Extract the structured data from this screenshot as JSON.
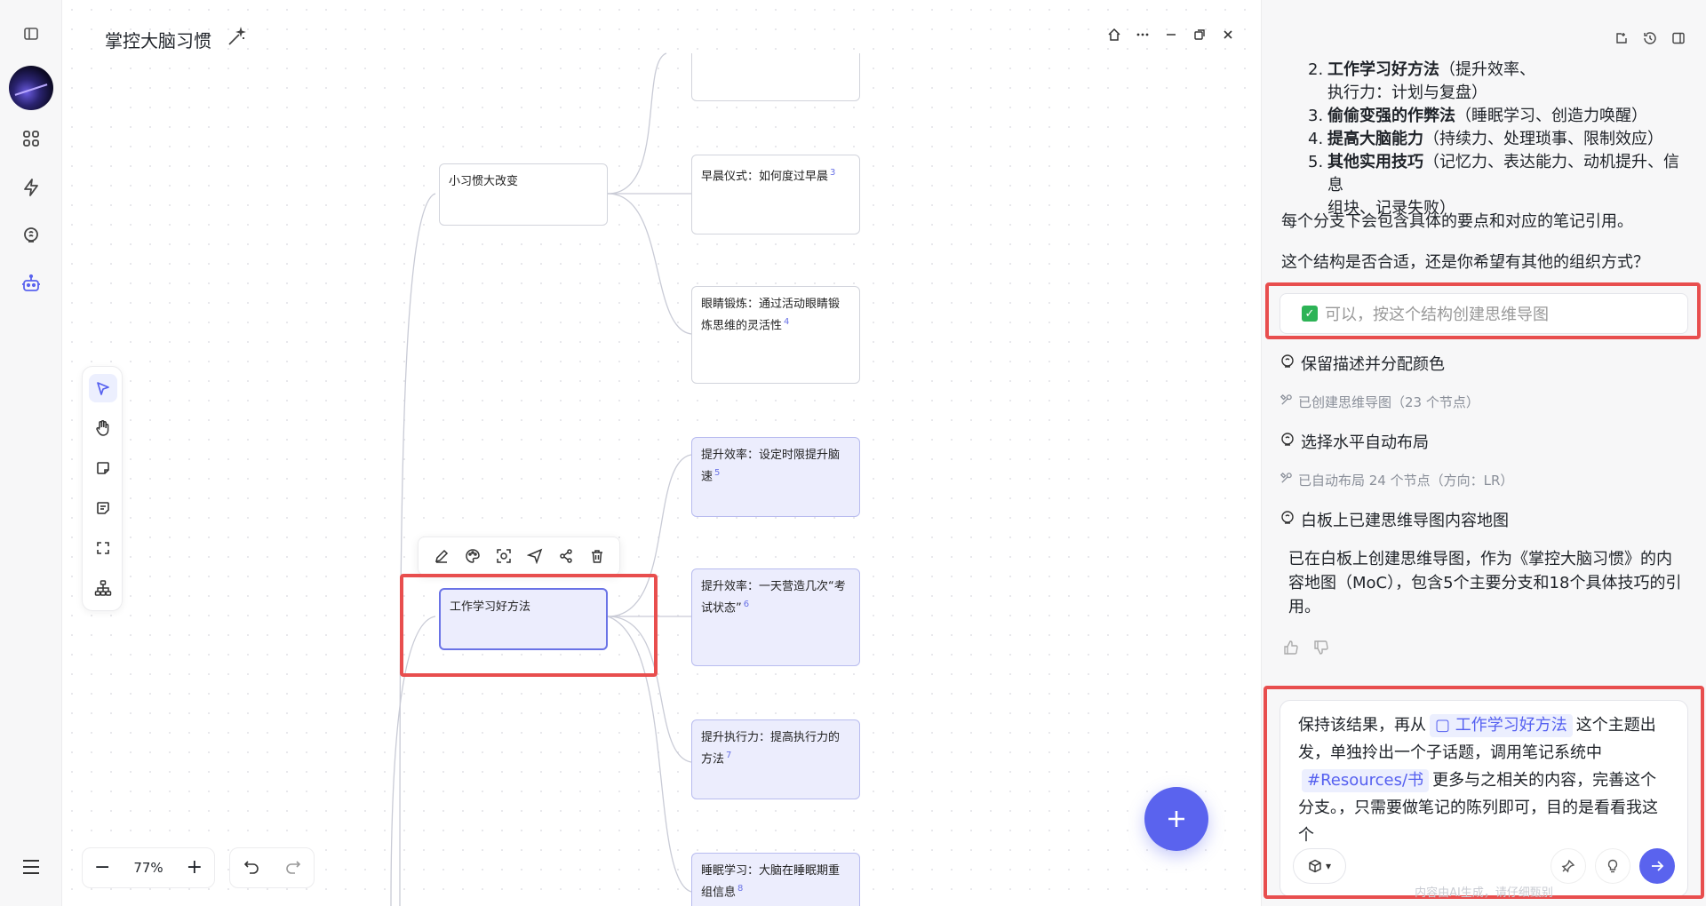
{
  "canvas": {
    "doc_title": "掌控大脑习惯",
    "zoom": "77%",
    "nodes": {
      "root_small": "小习惯大改变",
      "root_work": "工作学习好方法",
      "morning": "早晨仪式：如何度过早晨",
      "morning_ref": "3",
      "eye": "眼睛锻炼：通过活动眼睛锻炼思维的灵活性",
      "eye_ref": "4",
      "eff1": "提升效率：设定时限提升脑速",
      "eff1_ref": "5",
      "eff2": "提升效率：一天营造几次“考试状态”",
      "eff2_ref": "6",
      "exec": "提升执行力：提高执行力的方法",
      "exec_ref": "7",
      "sleep": "睡眠学习：大脑在睡眠期重组信息",
      "sleep_ref": "8"
    }
  },
  "panel": {
    "list": [
      {
        "num": "2.",
        "bold": "工作学习好方法",
        "rest": "（提升效率、",
        "cont": "执行力：计划与复盘）"
      },
      {
        "num": "3.",
        "bold": "偷偷变强的作弊法",
        "rest": "（睡眠学习、创造力唤醒）"
      },
      {
        "num": "4.",
        "bold": "提高大脑能力",
        "rest": "（持续力、处理琐事、限制效应）"
      },
      {
        "num": "5.",
        "bold": "其他实用技巧",
        "rest": "（记忆力、表达能力、动机提升、信息",
        "cont": "组块、记录失败）"
      }
    ],
    "note": "每个分支下会包含具体的要点和对应的笔记引用。",
    "question": "这个结构是否合适，还是你希望有其他的组织方式？",
    "quick_reply": "可以，按这个结构创建思维导图",
    "steps": {
      "s1": "保留描述并分配颜色",
      "s1_done": "已创建思维导图（23 个节点）",
      "s2": "选择水平自动布局",
      "s2_done": "已自动布局 24 个节点（方向：LR）",
      "s3": "白板上已建思维导图内容地图"
    },
    "result": "已在白板上创建思维导图，作为《掌控大脑习惯》的内容地图（MoC），包含5个主要分支和18个具体技巧的引用。",
    "composer": {
      "p1": "保持该结果，再从",
      "chip1": "工作学习好方法",
      "p2": "这个主题出发，单独拎出一个子话题，调用笔记系统中",
      "chip2": "#Resources/书",
      "p3": "更多与之相关的内容，完善这个分支。，只需要做笔记的陈列即可，目的是看看我这个"
    },
    "hint": "内容由AI生成，请仔细甄别"
  }
}
